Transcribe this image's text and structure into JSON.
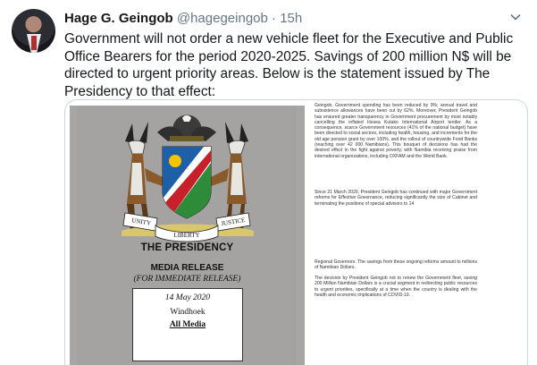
{
  "author": {
    "name": "Hage G. Geingob",
    "handle": "@hagegeingob",
    "separator": "·",
    "time": "15h"
  },
  "tweet": {
    "text": "Government will not order a new vehicle fleet for the Executive and Public Office Bearers for the period 2020-2025. Savings of 200 million N$ will be directed to urgent priority areas. Below is the statement issued by The Presidency to that effect:"
  },
  "icons": {
    "avatar": "profile-photo",
    "menu": "chevron-down-icon"
  },
  "release": {
    "emblem_banner_left": "UNITY",
    "emblem_banner_middle": "LIBERTY",
    "emblem_banner_right": "JUSTICE",
    "office": "THE PRESIDENCY",
    "heading": "MEDIA RELEASE",
    "subheading": "(FOR IMMEDIATE RELEASE)",
    "date": "14 May 2020",
    "place": "Windhoek",
    "audience": "All Media",
    "paragraph_1": "Geingob, Government spending has been reduced by 9%; annual travel and subsistence allowances have been cut by 62%. Moreover, President Geingob has ensured greater transparency in Government procurement by most notably cancelling the inflated Hosea Kutako International Airport tender. As a consequence, scarce Government resources (41% of the national budget) have been directed to social sectors, including health, housing, and increments for the old age pension grant by over 100%, and the rollout of countrywide Food Banks (reaching over 42 000 Namibians). This bouquet of decisions has had the desired effect in the fight against poverty, with Namibia receiving praise from international organizations, including OXFAM and the World Bank.",
    "paragraph_2": "Since 21 March 2020, President Geingob has continued with major Government reforms for Effective Governance, reducing significantly the size of Cabinet and terminating the positions of special advisors to 14",
    "paragraph_3": "Regional Governors. The savings from these ongoing reforms amount to millions of Namibian Dollars.",
    "paragraph_4": "The decision by President Geingob not to renew the Government fleet, saving 200 Million Namibian Dollars is a crucial segment in redirecting public resources to urgent priorities, specifically at a time when the country is dealing with the health and economic implications of COVID-19."
  },
  "colors": {
    "name": "#14171a",
    "meta": "#657786",
    "border": "#ccd6dd",
    "document_gray": "#a6a5a3"
  }
}
